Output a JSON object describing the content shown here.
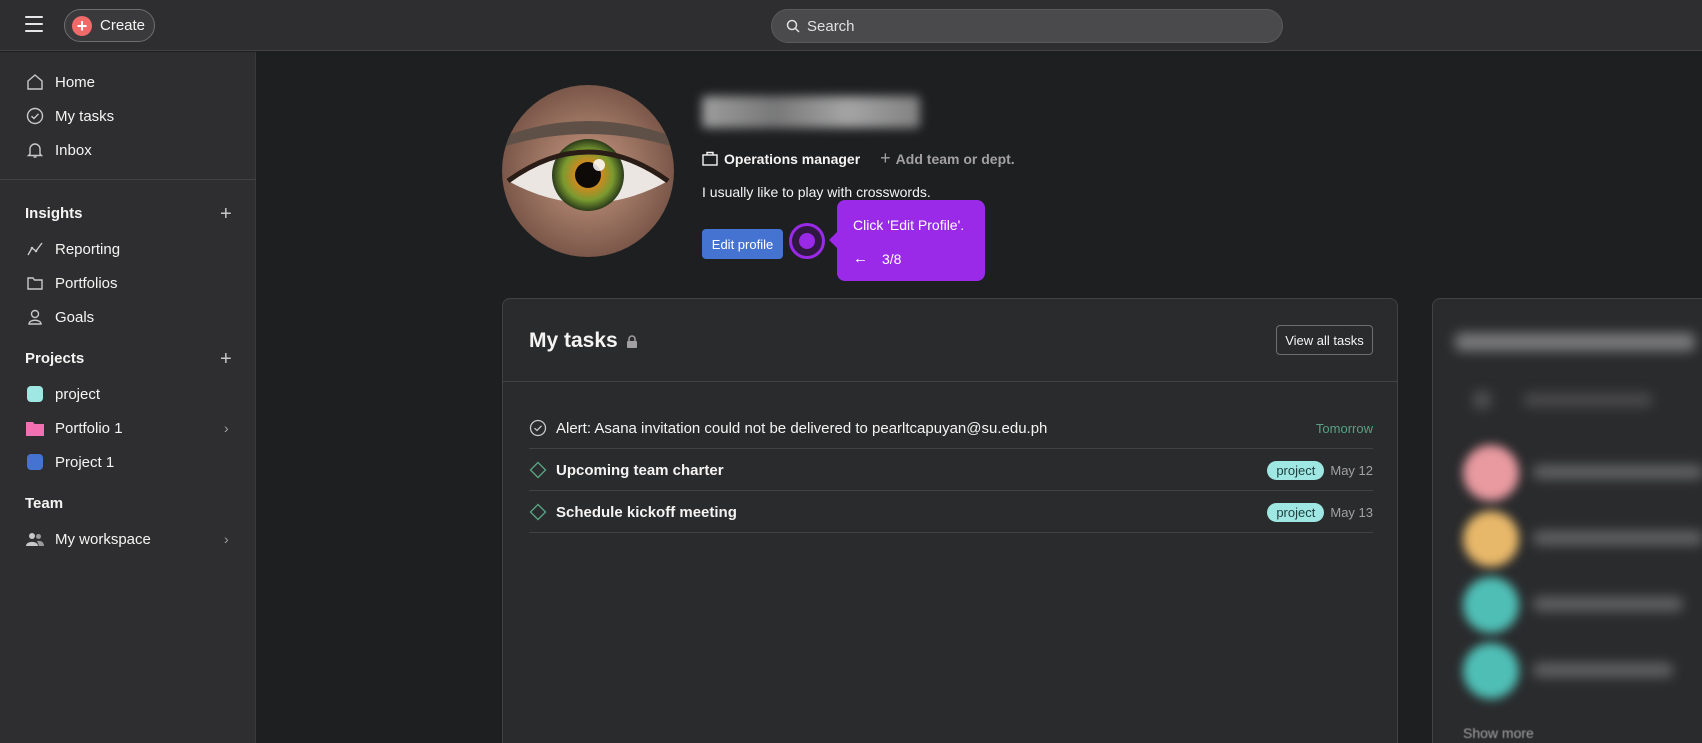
{
  "topbar": {
    "create_label": "Create",
    "search_placeholder": "Search"
  },
  "sidebar": {
    "main_items": [
      {
        "label": "Home",
        "icon": "home-icon"
      },
      {
        "label": "My tasks",
        "icon": "check-circle-icon"
      },
      {
        "label": "Inbox",
        "icon": "bell-icon"
      }
    ],
    "insights": {
      "title": "Insights",
      "items": [
        {
          "label": "Reporting",
          "icon": "line-chart-icon"
        },
        {
          "label": "Portfolios",
          "icon": "folder-icon"
        },
        {
          "label": "Goals",
          "icon": "person-goal-icon"
        }
      ]
    },
    "projects": {
      "title": "Projects",
      "items": [
        {
          "label": "project",
          "color": "#9ee7e3"
        },
        {
          "label": "Portfolio 1",
          "color": "#f26fb2"
        },
        {
          "label": "Project 1",
          "color": "#4573d2"
        }
      ]
    },
    "team": {
      "title": "Team",
      "items": [
        {
          "label": "My workspace",
          "icon": "team-icon"
        }
      ]
    }
  },
  "profile": {
    "role": "Operations manager",
    "add_team": "Add team or dept.",
    "bio": "I usually like to play with crosswords.",
    "edit_label": "Edit profile"
  },
  "tooltip": {
    "text": "Click 'Edit Profile'.",
    "step": "3/8",
    "color": "#9a2ae8"
  },
  "my_tasks": {
    "title": "My tasks",
    "view_all": "View all tasks",
    "tasks": [
      {
        "name": "Alert: Asana invitation could not be delivered to pearltcapuyan@su.edu.ph",
        "tag": "",
        "due": "Tomorrow"
      },
      {
        "name": "Upcoming team charter",
        "tag": "project",
        "due": "May 12"
      },
      {
        "name": "Schedule kickoff meeting",
        "tag": "project",
        "due": "May 13"
      }
    ]
  },
  "people_card": {
    "show_more": "Show more"
  }
}
